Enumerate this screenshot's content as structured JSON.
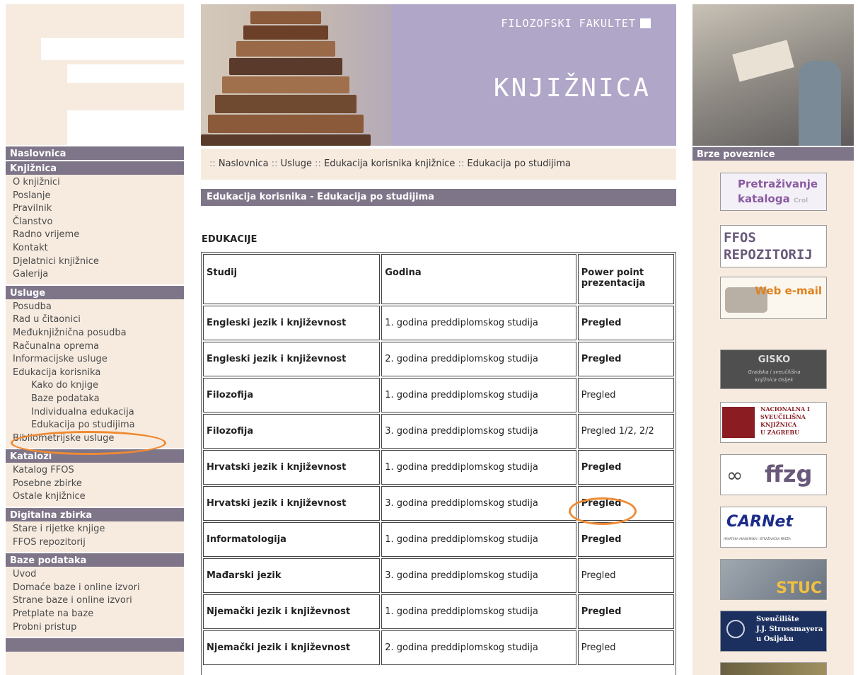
{
  "left_nav": {
    "naslovnica": "Naslovnica",
    "knjiznica": {
      "title": "Knjižnica",
      "items": [
        "O knjižnici",
        "Poslanje",
        "Pravilnik",
        "Članstvo",
        "Radno vrijeme",
        "Kontakt",
        "Djelatnici knjižnice",
        "Galerija"
      ]
    },
    "usluge": {
      "title": "Usluge",
      "items": [
        "Posudba",
        "Rad u čitaonici",
        "Međuknjižnična posudba",
        "Računalna oprema",
        "Informacijske usluge",
        "Edukacija korisnika"
      ],
      "sub_items": [
        "Kako do knjige",
        "Baze podataka",
        "Individualna edukacija",
        "Edukacija po studijima"
      ],
      "after": "Bibliometrijske usluge"
    },
    "katalozi": {
      "title": "Katalozi",
      "items": [
        "Katalog FFOS",
        "Posebne zbirke",
        "Ostale knjižnice"
      ]
    },
    "digitalna": {
      "title": "Digitalna zbirka",
      "items": [
        "Stare i rijetke knjige",
        "FFOS repozitorij"
      ]
    },
    "baze": {
      "title": "Baze podataka",
      "items": [
        "Uvod",
        "Domaće baze i online izvori",
        "Strane baze i online izvori",
        "Pretplate na baze",
        "Probni pristup"
      ]
    }
  },
  "header": {
    "faculty": "FILOZOFSKI FAKULTET",
    "title": "KNJIŽNICA"
  },
  "breadcrumb": {
    "sep": "::",
    "items": [
      "Naslovnica",
      "Usluge",
      "Edukacija korisnika knjižnice",
      "Edukacija po studijima"
    ]
  },
  "section_title": "Edukacija korisnika - Edukacija po studijima",
  "edu_heading": "EDUKACIJE",
  "table": {
    "headers": [
      "Studij",
      "Godina",
      "Power point prezentacija"
    ],
    "rows": [
      {
        "studij": "Engleski jezik i književnost",
        "godina": "1. godina preddiplomskog studija",
        "link": "Pregled"
      },
      {
        "studij": "Engleski jezik i književnost",
        "godina": "2. godina preddiplomskog studija",
        "link": "Pregled"
      },
      {
        "studij": "Filozofija",
        "godina": "1. godina preddiplomskog studija",
        "link": "Pregled"
      },
      {
        "studij": "Filozofija",
        "godina": "3. godina preddiplomskog studija",
        "link": "Pregled 1/2, 2/2"
      },
      {
        "studij": "Hrvatski jezik i književnost",
        "godina": "1. godina preddiplomskog studija",
        "link": "Pregled"
      },
      {
        "studij": "Hrvatski jezik i književnost",
        "godina": "3. godina preddiplomskog studija",
        "link": "Pregled"
      },
      {
        "studij": "Informatologija",
        "godina": "1. godina preddiplomskog studija",
        "link": "Pregled"
      },
      {
        "studij": "Mađarski jezik",
        "godina": "3. godina preddiplomskog studija",
        "link": "Pregled"
      },
      {
        "studij": "Njemački jezik i književnost",
        "godina": "1. godina preddiplomskog studija",
        "link": "Pregled"
      },
      {
        "studij": "Njemački jezik i književnost",
        "godina": "2. godina preddiplomskog studija",
        "link": "Pregled"
      }
    ]
  },
  "right": {
    "title": "Brze poveznice",
    "banners": {
      "pretrazivanje": {
        "line1": "Pretraživanje",
        "line2": "kataloga",
        "tag": "Crol"
      },
      "ffos": {
        "line1": "FFOS",
        "line2": "REPOZITORIJ"
      },
      "webmail": "Web e-mail",
      "gisko": {
        "logo": "GISKO",
        "line1": "Gradska i sveučilišna",
        "line2": "knjižnica Osijek"
      },
      "nsk": {
        "line1": "NACIONALNA I",
        "line2": "SVEUČILIŠNA",
        "line3": "KNJIŽNICA",
        "line4": "U ZAGREBU"
      },
      "ffzg": "ffzg",
      "carnet": {
        "name": "CARNet",
        "sub": "HRVATSKA AKADEMSKA I ISTRAŽIVAČKA MREŽA"
      },
      "stuc": "STUC",
      "sveuciliste": {
        "line1": "Sveučilište",
        "line2": "J.J. Strossmayera",
        "line3": "u Osijeku"
      }
    }
  }
}
